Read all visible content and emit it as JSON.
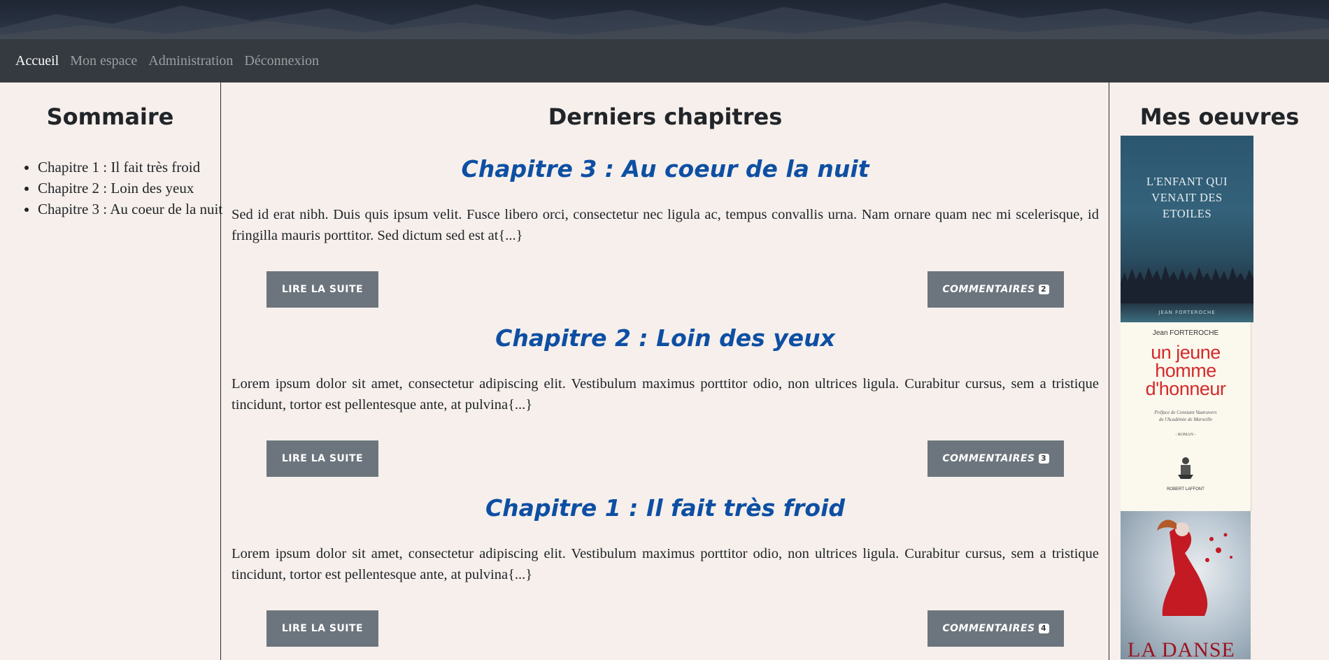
{
  "nav": {
    "items": [
      {
        "label": "Accueil",
        "active": true
      },
      {
        "label": "Mon espace",
        "active": false
      },
      {
        "label": "Administration",
        "active": false
      },
      {
        "label": "Déconnexion",
        "active": false
      }
    ]
  },
  "sommaire": {
    "title": "Sommaire",
    "items": [
      "Chapitre 1 : Il fait très froid",
      "Chapitre 2 : Loin des yeux",
      "Chapitre 3 : Au coeur de la nuit"
    ]
  },
  "main": {
    "title": "Derniers chapitres",
    "chapters": [
      {
        "title": "Chapitre 3 : Au coeur de la nuit",
        "excerpt": "Sed id erat nibh. Duis quis ipsum velit. Fusce libero orci, consectetur nec ligula ac, tempus convallis urna. Nam ornare quam nec mi scelerisque, id fringilla mauris porttitor. Sed dictum sed est at{...}",
        "read_label": "LIRE LA SUITE",
        "comments_label": "COMMENTAIRES",
        "comments_count": "2"
      },
      {
        "title": "Chapitre 2 : Loin des yeux",
        "excerpt": "Lorem ipsum dolor sit amet, consectetur adipiscing elit. Vestibulum maximus porttitor odio, non ultrices ligula. Curabitur cursus, sem a tristique tincidunt, tortor est pellentesque ante, at pulvina{...}",
        "read_label": "LIRE LA SUITE",
        "comments_label": "COMMENTAIRES",
        "comments_count": "3"
      },
      {
        "title": "Chapitre 1 : Il fait très froid",
        "excerpt": "Lorem ipsum dolor sit amet, consectetur adipiscing elit. Vestibulum maximus porttitor odio, non ultrices ligula. Curabitur cursus, sem a tristique tincidunt, tortor est pellentesque ante, at pulvina{...}",
        "read_label": "LIRE LA SUITE",
        "comments_label": "COMMENTAIRES",
        "comments_count": "4"
      }
    ]
  },
  "oeuvres": {
    "title": "Mes oeuvres",
    "books": [
      {
        "title": "L'ENFANT QUI\nVENAIT DES\nETOILES",
        "author": "JEAN FORTEROCHE"
      },
      {
        "author": "Jean FORTEROCHE",
        "title": "un jeune\nhomme\nd'honneur",
        "preface": "Préface de Constant Vautravers\nde l'Académie de Marseille",
        "genre": "- ROMAN -",
        "publisher": "ROBERT LAFFONT"
      },
      {
        "title": "LA DANSE"
      }
    ]
  },
  "colors": {
    "background": "#f6efeb",
    "navbar": "#343a40",
    "chapter_title": "#0d4fa3",
    "button": "#6c757d"
  }
}
